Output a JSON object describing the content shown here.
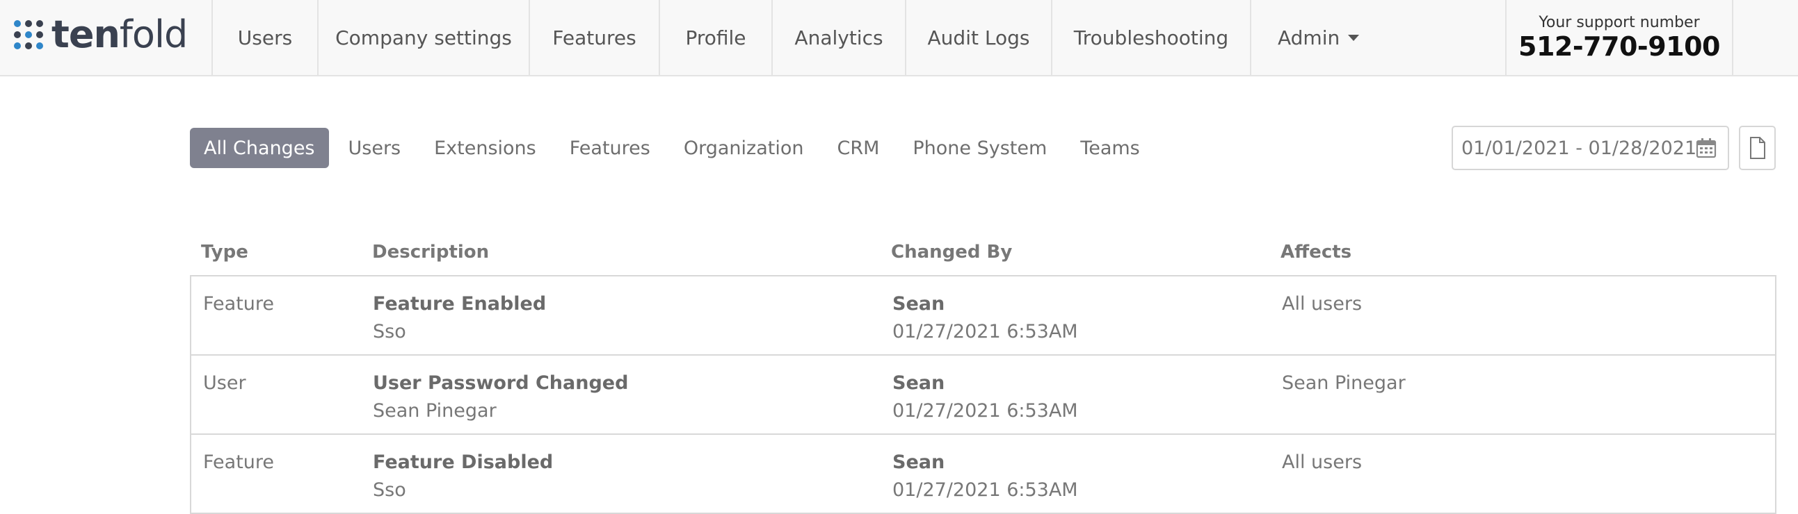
{
  "app": {
    "logo_bold": "ten",
    "logo_light": "fold"
  },
  "nav": {
    "items": [
      {
        "label": "Users"
      },
      {
        "label": "Company settings"
      },
      {
        "label": "Features"
      },
      {
        "label": "Profile"
      },
      {
        "label": "Analytics"
      },
      {
        "label": "Audit Logs"
      },
      {
        "label": "Troubleshooting"
      },
      {
        "label": "Admin"
      }
    ],
    "admin_caret_icon": "caret-down-icon"
  },
  "support": {
    "label": "Your support number",
    "number": "512-770-9100"
  },
  "filters": {
    "tabs": [
      {
        "label": "All Changes",
        "active": true
      },
      {
        "label": "Users"
      },
      {
        "label": "Extensions"
      },
      {
        "label": "Features"
      },
      {
        "label": "Organization"
      },
      {
        "label": "CRM"
      },
      {
        "label": "Phone System"
      },
      {
        "label": "Teams"
      }
    ],
    "date_range": "01/01/2021 - 01/28/2021",
    "calendar_icon": "calendar-icon",
    "export_icon": "file-icon"
  },
  "table": {
    "headers": {
      "type": "Type",
      "description": "Description",
      "changed_by": "Changed By",
      "affects": "Affects"
    },
    "rows": [
      {
        "type": "Feature",
        "title": "Feature Enabled",
        "detail": "Sso",
        "by": "Sean",
        "when": "01/27/2021 6:53AM",
        "affects": "All users"
      },
      {
        "type": "User",
        "title": "User Password Changed",
        "detail": "Sean Pinegar",
        "by": "Sean",
        "when": "01/27/2021 6:53AM",
        "affects": "Sean Pinegar"
      },
      {
        "type": "Feature",
        "title": "Feature Disabled",
        "detail": "Sso",
        "by": "Sean",
        "when": "01/27/2021 6:53AM",
        "affects": "All users"
      }
    ]
  },
  "colors": {
    "navbar_bg": "#f8f8f8",
    "active_pill": "#7f818f",
    "logo_dot_dark": "#3a4150",
    "logo_dot_blue": "#2f86c9"
  }
}
